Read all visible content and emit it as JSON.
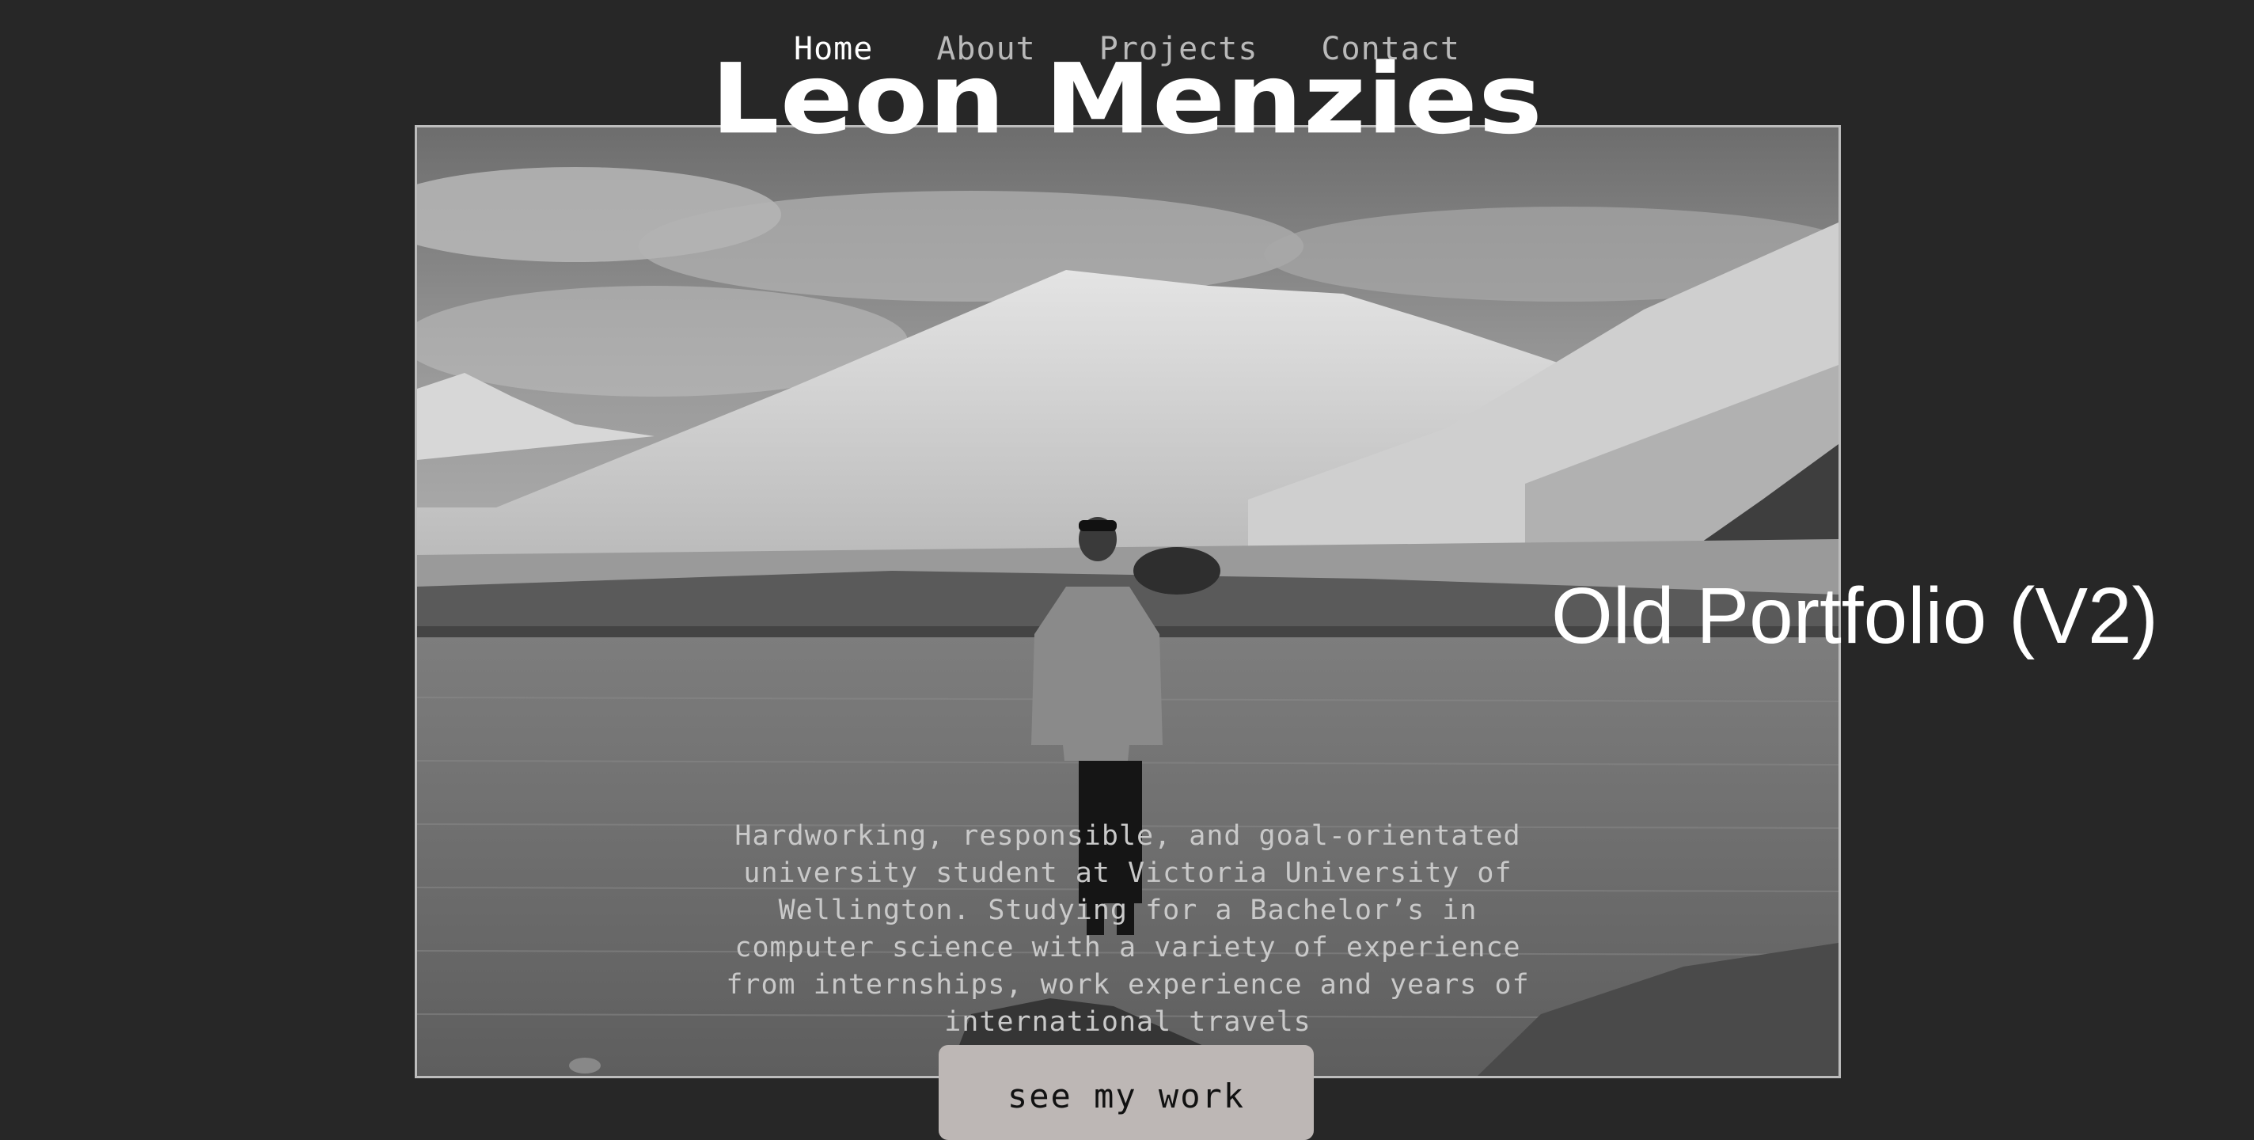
{
  "nav": {
    "items": [
      {
        "label": "Home",
        "active": true
      },
      {
        "label": "About",
        "active": false
      },
      {
        "label": "Projects",
        "active": false
      },
      {
        "label": "Contact",
        "active": false
      }
    ]
  },
  "hero": {
    "name": "Leon Menzies",
    "photo_icon": "landscape-photo-person-on-rock"
  },
  "overlay_label": "Old Portfolio (V2)",
  "bio": "Hardworking, responsible, and goal-orientated university student at Victoria University of Wellington. Studying for a Bachelor’s in computer science with a variety of experience from internships, work experience and years of international travels",
  "cta": {
    "label": "see my work"
  },
  "colors": {
    "background": "#272727",
    "nav_active": "#ffffff",
    "nav_inactive": "#b9b9b9",
    "button_bg": "#bdb7b5"
  }
}
